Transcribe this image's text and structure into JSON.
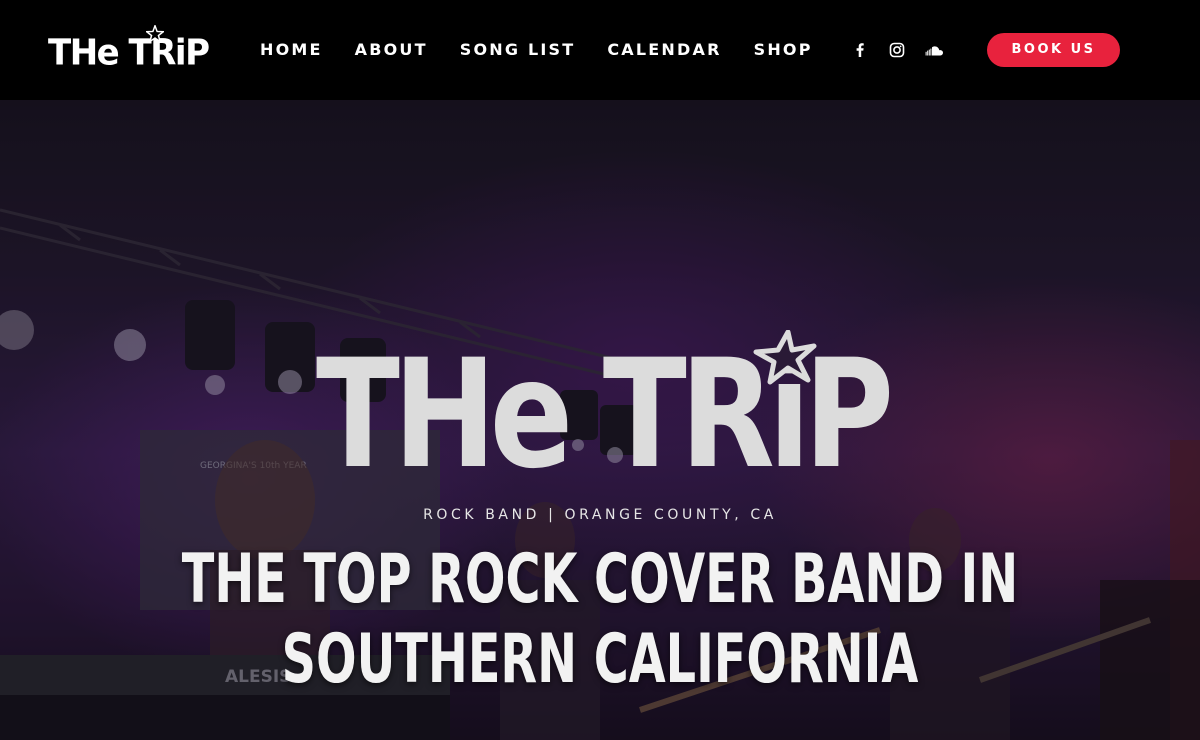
{
  "header": {
    "logo_text": "THe TRiP",
    "nav": [
      {
        "label": "HOME"
      },
      {
        "label": "ABOUT"
      },
      {
        "label": "SONG LIST"
      },
      {
        "label": "CALENDAR"
      },
      {
        "label": "SHOP"
      }
    ],
    "social": [
      {
        "icon": "facebook-icon"
      },
      {
        "icon": "instagram-icon"
      },
      {
        "icon": "soundcloud-icon"
      }
    ],
    "cta_label": "BOOK US"
  },
  "hero": {
    "logo_text": "THe TRiP",
    "tagline": "ROCK BAND | ORANGE COUNTY, CA",
    "headline": "THE TOP ROCK COVER BAND IN SOUTHERN CALIFORNIA",
    "keyboard_brand": "ALESIS",
    "banner_text": "GEORGINA'S 10th YEAR"
  },
  "colors": {
    "header_bg": "#000000",
    "accent": "#e8223d",
    "text": "#ffffff",
    "logo_gray": "#dcdcdc"
  }
}
